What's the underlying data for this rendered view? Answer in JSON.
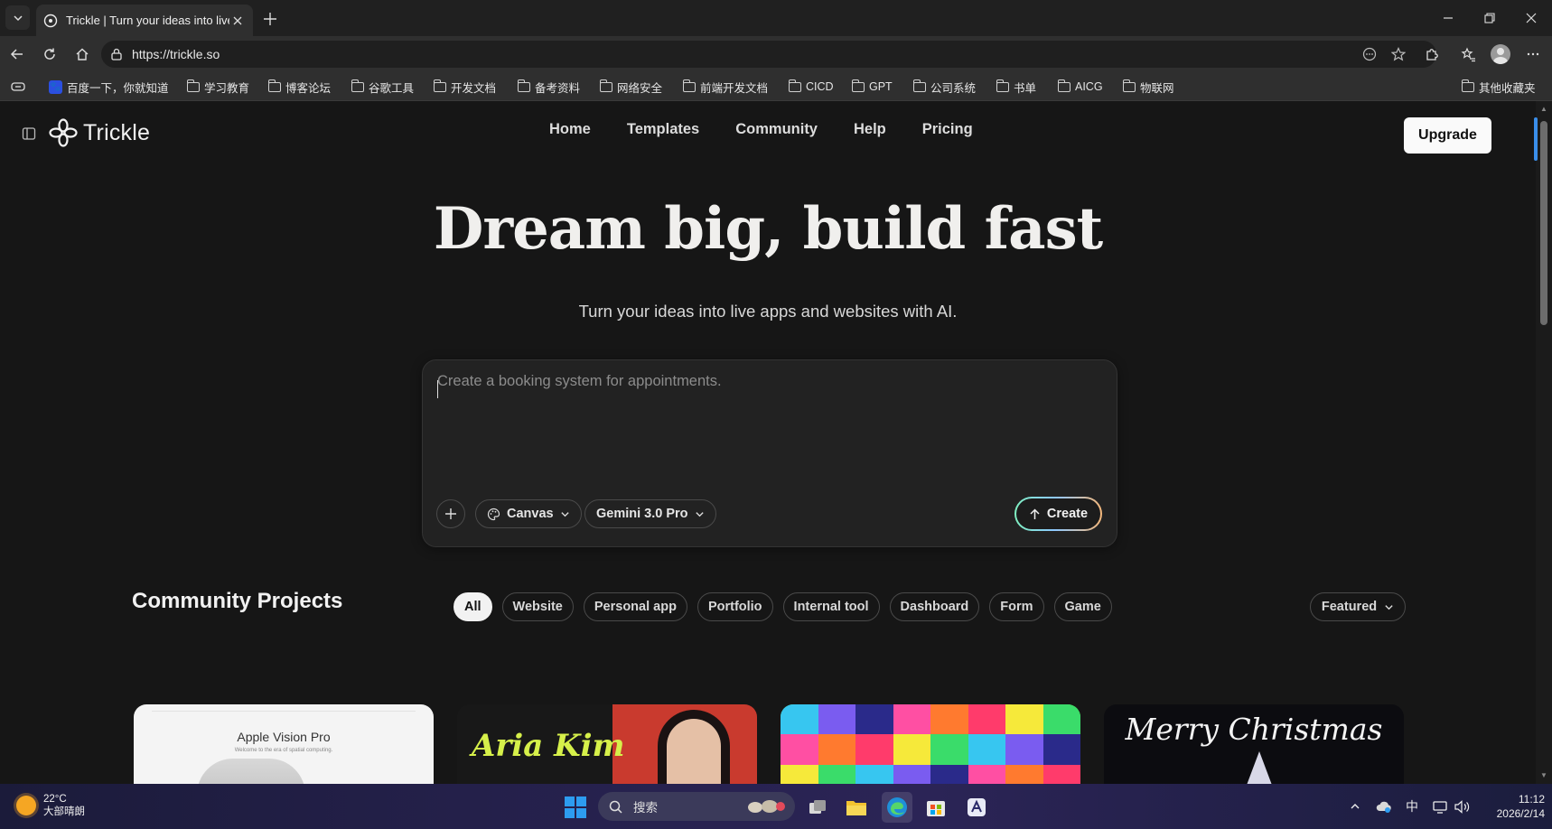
{
  "browser": {
    "tab_title": "Trickle | Turn your ideas into live ap",
    "url": "https://trickle.so",
    "bookmarks": [
      {
        "label": "百度一下，你就知道",
        "icon": "baidu"
      },
      {
        "label": "学习教育",
        "icon": "folder"
      },
      {
        "label": "博客论坛",
        "icon": "folder"
      },
      {
        "label": "谷歌工具",
        "icon": "folder"
      },
      {
        "label": "开发文档",
        "icon": "folder"
      },
      {
        "label": "备考资料",
        "icon": "folder"
      },
      {
        "label": "网络安全",
        "icon": "folder"
      },
      {
        "label": "前端开发文档",
        "icon": "folder"
      },
      {
        "label": "CICD",
        "icon": "folder"
      },
      {
        "label": "GPT",
        "icon": "folder"
      },
      {
        "label": "公司系统",
        "icon": "folder"
      },
      {
        "label": "书单",
        "icon": "folder"
      },
      {
        "label": "AICG",
        "icon": "folder"
      },
      {
        "label": "物联网",
        "icon": "folder"
      }
    ],
    "other_bookmarks": "其他收藏夹"
  },
  "site": {
    "logo_text": "Trickle",
    "nav": [
      "Home",
      "Templates",
      "Community",
      "Help",
      "Pricing"
    ],
    "upgrade_label": "Upgrade"
  },
  "hero": {
    "title": "Dream big, build fast",
    "subtitle": "Turn your ideas into live apps and websites with AI."
  },
  "prompt": {
    "placeholder": "Create a booking system for appointments.",
    "mode_label": "Canvas",
    "model_label": "Gemini 3.0 Pro",
    "create_label": "Create"
  },
  "community": {
    "title": "Community Projects",
    "filters": [
      "All",
      "Website",
      "Personal app",
      "Portfolio",
      "Internal tool",
      "Dashboard",
      "Form",
      "Game"
    ],
    "active_filter": "All",
    "sort_label": "Featured",
    "cards": [
      {
        "title": "Apple Vision Pro",
        "subtitle": "Welcome to the era of spatial computing."
      },
      {
        "title": "Aria Kim"
      },
      {
        "title": ""
      },
      {
        "title": "Merry Christmas"
      }
    ]
  },
  "taskbar": {
    "temperature": "22°C",
    "weather": "大部晴朗",
    "search_label": "搜索",
    "ime": "中",
    "time": "11:12",
    "date": "2026/2/14"
  },
  "colors": {
    "page_bg": "#161616",
    "create_gradient": [
      "#7ff0c0",
      "#8cc8ff",
      "#f5b77a"
    ]
  }
}
